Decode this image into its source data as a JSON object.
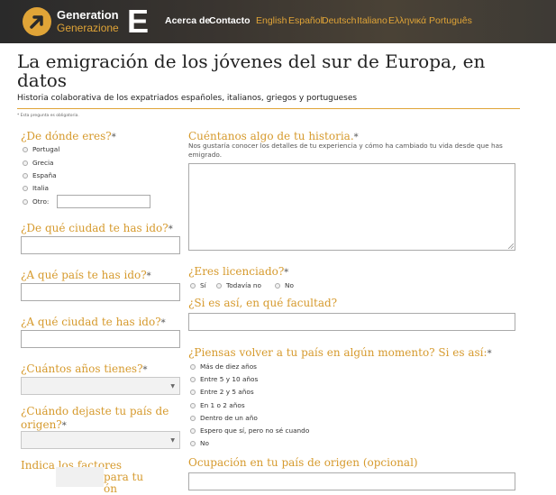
{
  "header": {
    "logo_line1": "Generation",
    "logo_line2": "Generazione",
    "logo_letter": "E",
    "nav": [
      "Acerca de",
      "Contacto"
    ],
    "languages": [
      "English",
      "Español",
      "Deutsch",
      "Italiano",
      "Ελληνικά",
      "Português"
    ]
  },
  "page": {
    "title": "La emigración de los jóvenes del sur de Europa, en datos",
    "subtitle": "Historia colaborativa de los expatriados españoles, italianos, griegos y portugueses",
    "required_note": "* Esta pregunta es obligatoria."
  },
  "left": {
    "q_origin": "¿De dónde eres?",
    "origin_options": [
      "Portugal",
      "Grecia",
      "España",
      "Italia",
      "Otro:"
    ],
    "q_city_went": "¿De qué ciudad te has ido?",
    "q_country_went": "¿A qué país te has ido?",
    "q_city_to": "¿A qué ciudad te has ido?",
    "q_age": "¿Cuántos años tienes?",
    "q_when_left": "¿Cuándo dejaste tu país de origen?",
    "q_factors_line1": "Indica los factores",
    "q_factors_line2": "para tu",
    "q_factors_line3": "ón"
  },
  "right": {
    "q_story": "Cuéntanos algo de tu historia.",
    "story_help": "Nos gustaría conocer los detalles de tu experiencia y cómo ha cambiado tu vida desde que has emigrado.",
    "q_graduate": "¿Eres licenciado?",
    "graduate_options": [
      "Sí",
      "Todavía no",
      "No"
    ],
    "q_faculty": "¿Si es así, en qué facultad?",
    "q_return": "¿Piensas volver a tu país en algún momento? Si es así:",
    "return_options": [
      "Más de diez años",
      "Entre 5 y 10 años",
      "Entre 2 y 5 años",
      "En 1 o 2 años",
      "Dentro de un año",
      "Espero que sí, pero no sé cuando",
      "No"
    ],
    "q_occupation": "Ocupación en tu país de origen (opcional)"
  },
  "required_mark": "*",
  "colors": {
    "accent": "#e0a437",
    "question": "#d69a2d",
    "header_bg": "#2f2c28"
  }
}
